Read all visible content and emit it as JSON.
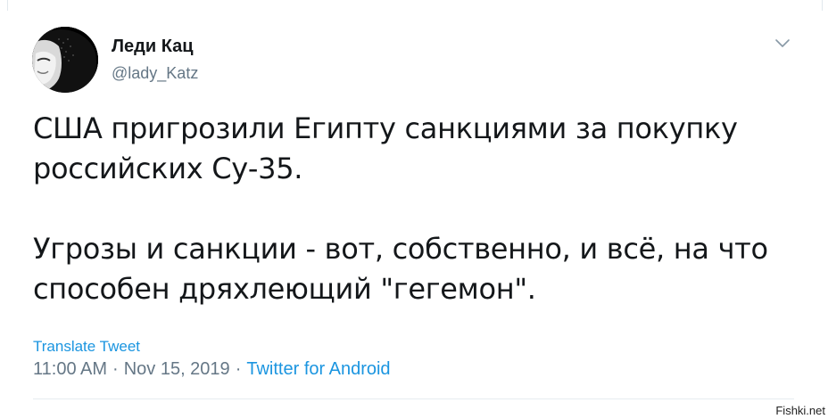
{
  "author": {
    "display_name": "Леди Кац",
    "handle": "@lady_Katz"
  },
  "tweet": {
    "lines": [
      "США пригрозили Египту санкциями за покупку",
      "российских Су-35.",
      "",
      "Угрозы и санкции - вот, собственно, и всё, на что",
      "способен дряхлеющий \"гегемон\"."
    ],
    "translate_label": "Translate Tweet",
    "time": "11:00 AM",
    "date": "Nov 15, 2019",
    "separator": "·",
    "source": "Twitter for Android"
  },
  "icons": {
    "menu": "chevron-down-icon"
  },
  "watermark": "Fishki.net",
  "colors": {
    "text": "#14171a",
    "secondary": "#657786",
    "link": "#1b95e0",
    "divider": "#e6ecf0"
  }
}
